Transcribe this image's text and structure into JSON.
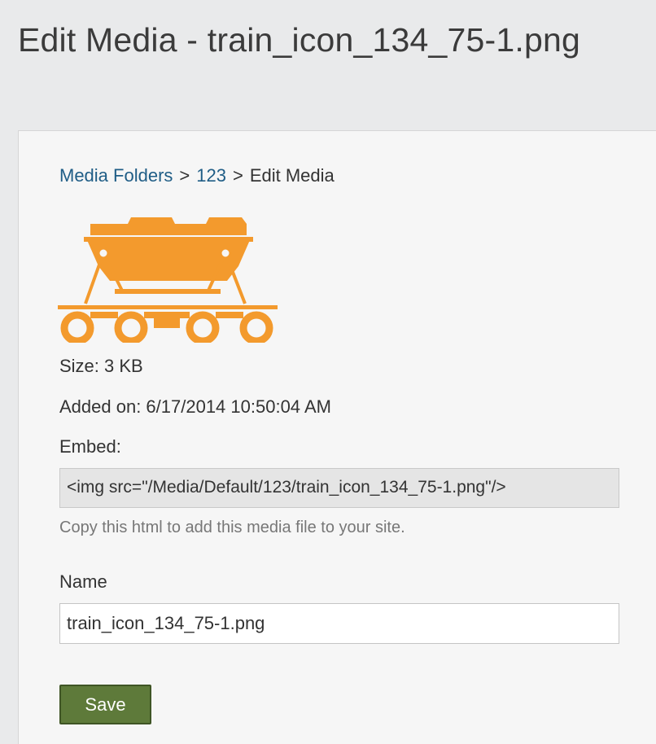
{
  "header": {
    "title": "Edit Media - train_icon_134_75-1.png"
  },
  "breadcrumb": {
    "items": [
      "Media Folders",
      "123"
    ],
    "separator": ">",
    "current": "Edit Media"
  },
  "media": {
    "icon": "train-wagon-icon",
    "icon_color": "#f39a2d",
    "size_label": "Size: 3 KB",
    "added_label": "Added on: 6/17/2014 10:50:04 AM",
    "embed_label": "Embed:",
    "embed_code": "<img src=\"/Media/Default/123/train_icon_134_75-1.png\"/>",
    "embed_help": "Copy this html to add this media file to your site."
  },
  "form": {
    "name_label": "Name",
    "name_value": "train_icon_134_75-1.png",
    "save_label": "Save"
  },
  "colors": {
    "link": "#1f5d86",
    "save_button": "#5e7a3a",
    "background": "#e9eaeb",
    "panel": "#f6f6f6"
  }
}
